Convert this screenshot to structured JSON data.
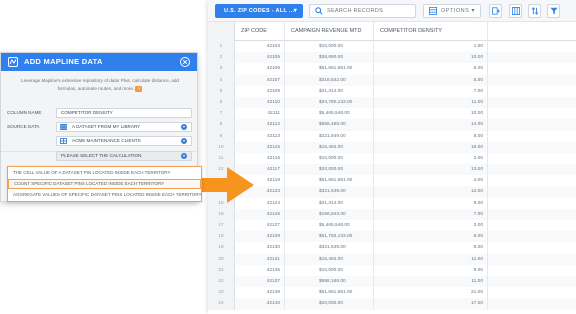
{
  "toolbar": {
    "dataset_label": "U.S. ZIP CODES - ALL ...",
    "dataset_chevron": "▾",
    "search_placeholder": "SEARCH RECORDS",
    "options_label": "OPTIONS",
    "options_chevron": "▾",
    "icons": [
      "add-column-icon",
      "split-columns-icon",
      "sort-icon",
      "filter-icon"
    ]
  },
  "table": {
    "columns": [
      "ZIP CODE",
      "CAMPAIGN REVENUE MTD",
      "COMPETITOR DENSITY"
    ],
    "rows": [
      {
        "idx": "1",
        "zip": "42103",
        "rev": "$10,000.00",
        "den": "1.00"
      },
      {
        "idx": "2",
        "zip": "42105",
        "rev": "$36,690.00",
        "den": "10.00"
      },
      {
        "idx": "3",
        "zip": "42106",
        "rev": "$51,651,651.00",
        "den": "6.00"
      },
      {
        "idx": "4",
        "zip": "42107",
        "rev": "$316,542.00",
        "den": "5.00"
      },
      {
        "idx": "5",
        "zip": "42109",
        "rev": "$21,314.00",
        "den": "7.00"
      },
      {
        "idx": "6",
        "zip": "42110",
        "rev": "$34,780,133.00",
        "den": "11.00"
      },
      {
        "idx": "7",
        "zip": "42111",
        "rev": "$5,465,546.00",
        "den": "10.00"
      },
      {
        "idx": "8",
        "zip": "42112",
        "rev": "$655,458.00",
        "den": "14.00"
      },
      {
        "idx": "9",
        "zip": "42113",
        "rev": "$321,649.00",
        "den": "8.00"
      },
      {
        "idx": "10",
        "zip": "42115",
        "rev": "$15,464.00",
        "den": "16.00"
      },
      {
        "idx": "11",
        "zip": "42116",
        "rev": "$10,000.00",
        "den": "2.00"
      },
      {
        "idx": "12",
        "zip": "42117",
        "rev": "$20,000.00",
        "den": "13.00"
      },
      {
        "idx": "13",
        "zip": "42119",
        "rev": "$51,651,651.00",
        "den": "4.00"
      },
      {
        "idx": "14",
        "zip": "42123",
        "rev": "$321,649.00",
        "den": "12.00"
      },
      {
        "idx": "15",
        "zip": "42124",
        "rev": "$21,314.00",
        "den": "9.00"
      },
      {
        "idx": "16",
        "zip": "42126",
        "rev": "$156,843.00",
        "den": "7.00"
      },
      {
        "idx": "17",
        "zip": "42127",
        "rev": "$5,465,546.00",
        "den": "3.00"
      },
      {
        "idx": "18",
        "zip": "42129",
        "rev": "$51,783,133.00",
        "den": "6.00"
      },
      {
        "idx": "19",
        "zip": "42130",
        "rev": "$321,649.00",
        "den": "8.00"
      },
      {
        "idx": "20",
        "zip": "42131",
        "rev": "$15,464.00",
        "den": "11.00"
      },
      {
        "idx": "21",
        "zip": "42135",
        "rev": "$10,000.00",
        "den": "9.00"
      },
      {
        "idx": "22",
        "zip": "42137",
        "rev": "$958,168.00",
        "den": "11.00"
      },
      {
        "idx": "23",
        "zip": "42139",
        "rev": "$51,651,651.00",
        "den": "21.00"
      },
      {
        "idx": "24",
        "zip": "42140",
        "rev": "$20,000.00",
        "den": "17.00"
      }
    ]
  },
  "dialog": {
    "title": "ADD MAPLINE DATA",
    "description_line1": "Leverage Mapline's extensive repository of data! Plus, calculate distance, add",
    "description_line2": "formulas, automate routes, and more.",
    "help_badge": "?",
    "column_name_label": "COLUMN NAME",
    "column_name_value": "COMPETITOR DENSITY",
    "source_data_label": "SOURCE DATA",
    "source_data_value": "A DATASET FROM MY LIBRARY",
    "dataset_value": "ACME MAINTENANCE CLIENTS",
    "calculation_value": "PLEASE SELECT THE CALCULATION"
  },
  "menu": {
    "items": [
      "THE CELL VALUE OF A DATASET PIN LOCATED INSIDE EACH TERRITORY",
      "COUNT SPECIFIC DATASET PINS LOCATED INSIDE EACH TERRITORY",
      "AGGREGATE VALUES OF SPECIFIC DATASET PINS LOCATED INSIDE EACH TERRITORY"
    ],
    "highlighted_index": 1
  },
  "colors": {
    "accent_blue": "#2f80ed",
    "arrow_orange": "#f7941d"
  }
}
